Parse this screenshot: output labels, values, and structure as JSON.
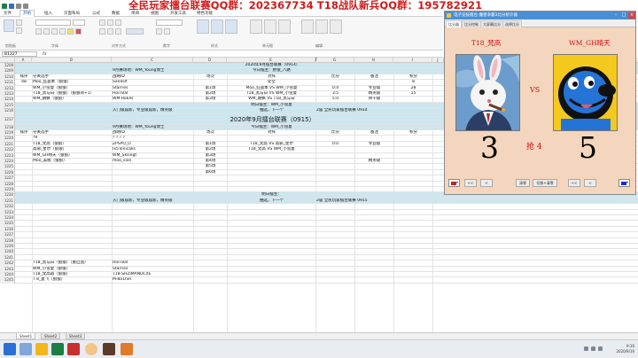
{
  "banner": {
    "text": "全民玩家擂台联赛QQ群：202367734  T18战队新兵QQ群：195782921"
  },
  "excel": {
    "tabs": [
      "文件",
      "开始",
      "插入",
      "页面布局",
      "公式",
      "数据",
      "审阅",
      "视图",
      "开发工具",
      "特色功能"
    ],
    "group_labels": [
      "剪贴板",
      "字体",
      "对齐方式",
      "数字",
      "样式",
      "单元格",
      "编辑"
    ],
    "name_box": "B1227",
    "fx": "fx",
    "columns": [
      "A",
      "B",
      "C",
      "D",
      "E",
      "F",
      "G",
      "H",
      "I",
      "J",
      "K",
      "L",
      "M",
      "N",
      "O",
      "P",
      "Q"
    ],
    "sheet_tabs": [
      "Sheet1",
      "Sheet2",
      "Sheet3"
    ]
  },
  "sheet": {
    "rows": [
      {
        "n": "1208",
        "type": "blue",
        "cells": {
          "title": "2020年9月擂台联赛（0914）"
        }
      },
      {
        "n": "1209",
        "type": "blue",
        "cells": {
          "c": "9月赛场地：WM_Young博士",
          "e": "今日擂主：野狼_八路"
        }
      },
      {
        "n": "1210",
        "cells": {
          "a": "排序",
          "b": "守关选手",
          "c": "战网ID",
          "d": "场次",
          "e": "对阵",
          "g": "比分",
          "h": "备注",
          "i": "积分"
        }
      },
      {
        "n": "1211",
        "cells": {
          "a": "48",
          "b": "Moo_狂盗本（狼狼）",
          "c": "Sandslf",
          "e": "轮空",
          "i": "8"
        }
      },
      {
        "n": "1212",
        "cells": {
          "b": "WM_小雪夏（狼狼）",
          "c": "Starries",
          "d": "第1场",
          "e": "Moo_狂盗本 VS WM_小雪夏",
          "g": "0:4",
          "h": "专业级",
          "i": "28"
        }
      },
      {
        "n": "1213",
        "cells": {
          "b": "T18_黑与白（狼狼）（狼狼哥+1）",
          "c": "HoiTBal",
          "d": "第2场",
          "e": "T18_黑与白 VS WM_小雪夏",
          "g": "3:5",
          "h": "精英级",
          "i": "15"
        }
      },
      {
        "n": "1214",
        "cells": {
          "b": "WM_朗枫（狼狼）",
          "c": "WM-Rok4s",
          "d": "第3场",
          "e": "WM_朗枫 VS T18_黑与白",
          "g": "5:0",
          "h": "骨干级"
        }
      },
      {
        "n": "1215",
        "type": "blue",
        "cells": {
          "e": "明日擂主：WM_小雪夏"
        }
      },
      {
        "n": "1216",
        "type": "blue",
        "cells": {
          "c": "入门级届新，专业级届新，精英级",
          "e": "抽选，下一个",
          "g": "2届 全民玩家擂台联赛 0914"
        }
      },
      {
        "n": "1217",
        "type": "blue",
        "tall": true,
        "cells": {
          "title": "2020年9月擂台联赛（0915）"
        }
      },
      {
        "n": "1218",
        "type": "blue",
        "cells": {
          "c": "9月赛场地：WM_Young博士",
          "e": "今日擂主：WM_小雪夏"
        }
      },
      {
        "n": "1219",
        "cells": {
          "a": "排序",
          "b": "守关选手",
          "c": "战网ID",
          "d": "场次",
          "e": "对阵",
          "g": "比分",
          "h": "备注",
          "i": "积分"
        }
      },
      {
        "n": "1220",
        "cells": {
          "b": "?9",
          "c": "? ? ? ?"
        }
      },
      {
        "n": "1221",
        "cells": {
          "b": "T18_梵高（狼狼）",
          "c": "ZPSPO_O",
          "d": "第1场",
          "e": "T18_梵高 VS 高邪_星尔",
          "g": "0:0",
          "h": "专业级"
        }
      },
      {
        "n": "1222",
        "cells": {
          "b": "高邪_星尔（狼狼）",
          "c": "Ix5Tonicaks",
          "d": "第2场",
          "e": "T18_梵高 VS WM_小雪夏"
        }
      },
      {
        "n": "1223",
        "cells": {
          "b": "WM_GH晴天（狼狼）",
          "c": "WM_Sksingt",
          "d": "第3场"
        }
      },
      {
        "n": "1224",
        "cells": {
          "b": "Moo_美桃（狼狼）",
          "c": "moo_sion",
          "d": "第4场",
          "h": "精英级"
        }
      },
      {
        "n": "1225",
        "cells": {
          "d": "第5场"
        }
      },
      {
        "n": "1226",
        "cells": {
          "d": "第6场"
        }
      },
      {
        "n": "1227",
        "cells": {}
      },
      {
        "n": "1228",
        "cells": {}
      },
      {
        "n": "1229",
        "cells": {}
      },
      {
        "n": "1230",
        "type": "blue",
        "cells": {
          "e": "明日擂主："
        }
      },
      {
        "n": "1231",
        "type": "blue",
        "cells": {
          "c": "入门级届新，专业级届新，精英级",
          "e": "抽选，下一个",
          "g": "2届 全民玩家擂台联赛 0915"
        }
      },
      {
        "n": "1232",
        "cells": {}
      },
      {
        "n": "1233",
        "cells": {}
      },
      {
        "n": "1234",
        "cells": {}
      },
      {
        "n": "1235",
        "cells": {}
      },
      {
        "n": "1236",
        "cells": {}
      },
      {
        "n": "1237",
        "cells": {}
      },
      {
        "n": "1238",
        "cells": {}
      },
      {
        "n": "1239",
        "cells": {}
      },
      {
        "n": "1240",
        "cells": {}
      },
      {
        "n": "1241",
        "cells": {}
      },
      {
        "n": "1242",
        "cells": {
          "b": "T18_黑与白（狼狼）（重启战）",
          "c": "HoiTBal"
        }
      },
      {
        "n": "1243",
        "cells": {
          "b": "WM_小雪夏（狼狼）",
          "c": "Starries"
        }
      },
      {
        "n": "1244",
        "cells": {
          "b": "T18_梵高斑（狼狼）",
          "c": "T18-SHZIMANDCXE"
        }
      },
      {
        "n": "1245",
        "cells": {
          "b": "T 8_夏飞（狼狼）",
          "c": "M-Ba1hel"
        }
      }
    ]
  },
  "scoreboard": {
    "title": "电子竞技擂台-魔兽争霸3比分统计器",
    "tabs": [
      "比分器",
      "比分控制",
      "大屏幕比分",
      "选择比分"
    ],
    "left_player": "T18_梵高",
    "right_player": "WM_GH晴天",
    "vs": "VS",
    "left_score": "3",
    "right_score": "5",
    "race_label": "抢  4",
    "buttons": [
      "<<",
      "<",
      "清零",
      "切换+清零",
      "<<",
      "<"
    ],
    "left_color": "#c0202a",
    "right_color": "#1a2cd6"
  },
  "taskbar": {
    "time": "9:16",
    "date": "2020/9/16"
  }
}
